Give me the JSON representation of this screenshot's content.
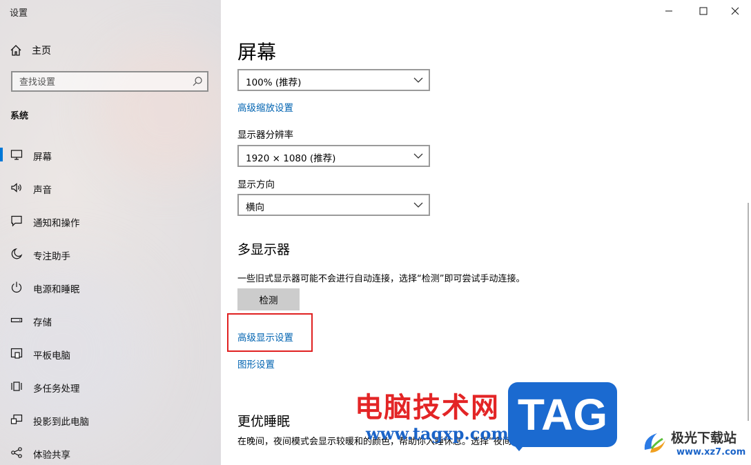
{
  "window": {
    "title": "设置"
  },
  "sidebar": {
    "home_label": "主页",
    "search_placeholder": "查找设置",
    "section_label": "系统",
    "items": [
      {
        "label": "屏幕",
        "icon": "monitor-icon",
        "active": true
      },
      {
        "label": "声音",
        "icon": "speaker-icon"
      },
      {
        "label": "通知和操作",
        "icon": "notification-icon"
      },
      {
        "label": "专注助手",
        "icon": "moon-icon"
      },
      {
        "label": "电源和睡眠",
        "icon": "power-icon"
      },
      {
        "label": "存储",
        "icon": "storage-icon"
      },
      {
        "label": "平板电脑",
        "icon": "tablet-icon"
      },
      {
        "label": "多任务处理",
        "icon": "multitask-icon"
      },
      {
        "label": "投影到此电脑",
        "icon": "project-icon"
      },
      {
        "label": "体验共享",
        "icon": "share-icon"
      }
    ]
  },
  "main": {
    "title": "屏幕",
    "scale_value": "100% (推荐)",
    "advanced_scale_link": "高级缩放设置",
    "resolution_label": "显示器分辨率",
    "resolution_value": "1920 × 1080 (推荐)",
    "orientation_label": "显示方向",
    "orientation_value": "横向",
    "multi_display_heading": "多显示器",
    "multi_display_desc": "一些旧式显示器可能不会进行自动连接，选择“检测”即可尝试手动连接。",
    "detect_button": "检测",
    "advanced_display_link": "高级显示设置",
    "graphics_link": "图形设置",
    "night_heading": "更优睡眠",
    "night_desc": "在晚间，夜间模式会显示较暖和的颜色，帮助你入睡休息。选择“夜间模式设置”进行设置。"
  },
  "watermark": {
    "site_name": "电脑技术网",
    "site_url": "www.tagxp.com",
    "tag": "TAG",
    "brand": "极光下载站",
    "brand_url": "www.xz7.com"
  },
  "colors": {
    "accent": "#0078d7",
    "link": "#0063b1",
    "highlight": "#e02020"
  }
}
